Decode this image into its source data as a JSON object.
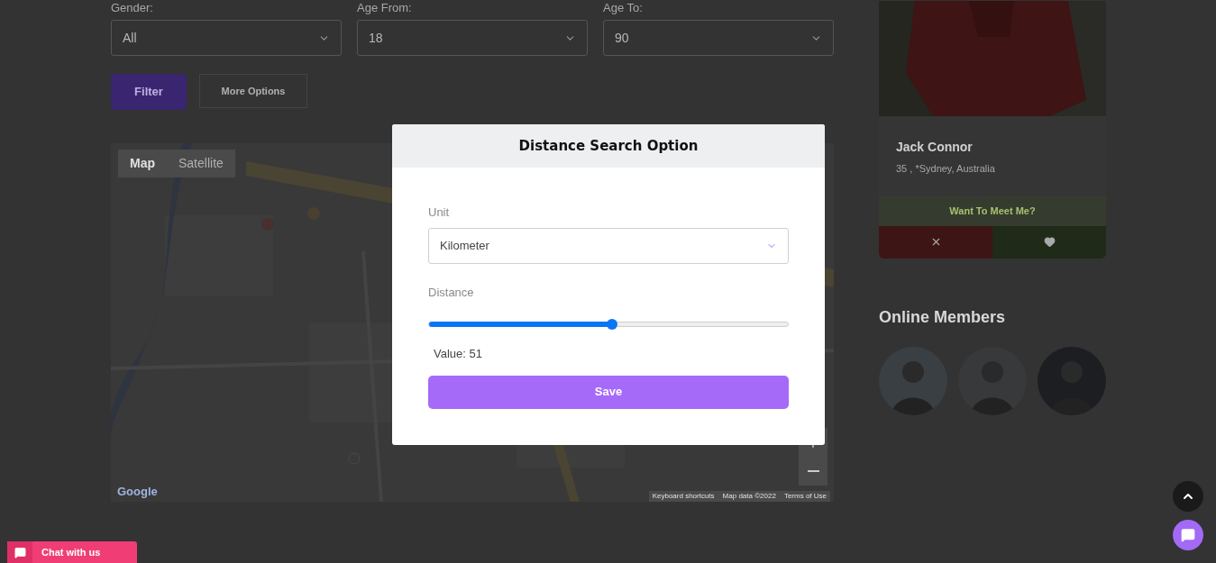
{
  "filters": [
    {
      "label": "Gender:",
      "value": "All"
    },
    {
      "label": "Age From:",
      "value": "18"
    },
    {
      "label": "Age To:",
      "value": "90"
    }
  ],
  "filter_button": "Filter",
  "more_options_button": "More Options",
  "map": {
    "view_tabs": [
      {
        "label": "Map",
        "selected": true
      },
      {
        "label": "Satellite",
        "selected": false
      }
    ],
    "logo_text": "Google",
    "footer_links": [
      "Keyboard shortcuts",
      "Map data ©2022",
      "Terms of Use"
    ]
  },
  "profile_card": {
    "name": "Jack Connor",
    "details": "35 , *Sydney, Australia",
    "prompt": "Want To Meet Me?"
  },
  "online_members": {
    "title": "Online Members"
  },
  "chat_widget": {
    "label": "Chat with us"
  },
  "modal": {
    "title": "Distance Search Option",
    "unit_label": "Unit",
    "unit_value": "Kilometer",
    "distance_label": "Distance",
    "distance": {
      "level": 0.51
    },
    "value_text": "Value: 51",
    "save_button": "Save"
  }
}
